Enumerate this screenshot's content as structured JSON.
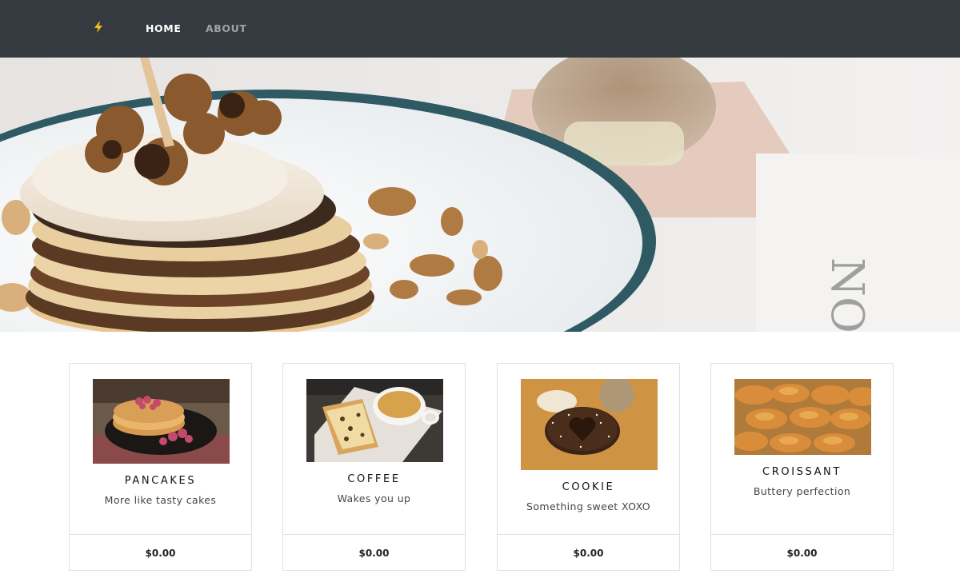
{
  "nav": {
    "brand_icon": "lightning-bolt-icon",
    "brand_color": "#f2c21d",
    "background": "#343a40",
    "links": [
      {
        "label": "HOME",
        "active": true
      },
      {
        "label": "ABOUT",
        "active": false
      }
    ]
  },
  "hero": {
    "image": "pancake-stack-with-nuts-and-coffee-photo"
  },
  "products": [
    {
      "title": "PANCAKES",
      "description": "More like tasty cakes",
      "image": "pancakes-with-raspberries-photo",
      "price": "$0.00"
    },
    {
      "title": "COFFEE",
      "description": "Wakes you up",
      "image": "coffee-cup-with-fruit-bread-photo",
      "price": "$0.00"
    },
    {
      "title": "COOKIE",
      "description": "Something sweet XOXO",
      "image": "heart-cookie-photo",
      "price": "$0.00"
    },
    {
      "title": "CROISSANT",
      "description": "Buttery perfection",
      "image": "croissants-basket-photo",
      "price": "$0.00"
    }
  ]
}
